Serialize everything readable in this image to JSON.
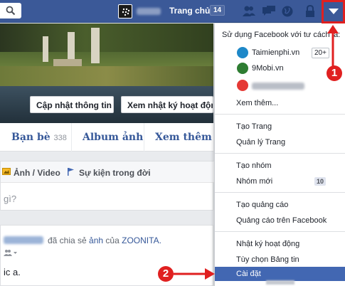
{
  "topbar": {
    "home_label": "Trang chủ",
    "home_count": "14"
  },
  "cover": {
    "update_info_label": "Cập nhật thông tin",
    "view_activity_label": "Xem nhật ký hoạt động"
  },
  "tabs": {
    "friends_label": "Bạn bè",
    "friends_count": "338",
    "album_label": "Album ảnh",
    "more_label": "Xem thêm"
  },
  "composer": {
    "photo_video_label": "Ảnh / Video",
    "life_event_label": "Sự kiện trong đời",
    "placeholder": "gì?"
  },
  "post": {
    "shared_text": "đã chia sẻ",
    "photo_link": "ảnh",
    "of_text": "của",
    "page_link": "ZOONITA.",
    "body_text": "ic a."
  },
  "dropdown": {
    "header": "Sử dụng Facebook với tư cách là:",
    "pages": [
      {
        "name": "Taimienphi.vn",
        "badge": "20+",
        "logo_color": "#1e88c8"
      },
      {
        "name": "9Mobi.vn",
        "badge": "",
        "logo_color": "#2e7d32"
      }
    ],
    "see_more": "Xem thêm...",
    "items": {
      "create_page": "Tạo Trang",
      "manage_pages": "Quản lý Trang",
      "create_group": "Tạo nhóm",
      "new_groups": "Nhóm mới",
      "new_groups_count": "10",
      "create_ads": "Tạo quảng cáo",
      "ads_on_facebook": "Quảng cáo trên Facebook",
      "activity_log": "Nhật ký hoạt động",
      "news_feed_prefs": "Tùy chọn Bảng tin",
      "settings": "Cài đặt"
    }
  },
  "annotations": {
    "step1": "1",
    "step2": "2"
  },
  "colors": {
    "facebook_blue": "#3b5998",
    "link_blue": "#365899",
    "highlight": "#4267b2",
    "annotation_red": "#e02020"
  }
}
